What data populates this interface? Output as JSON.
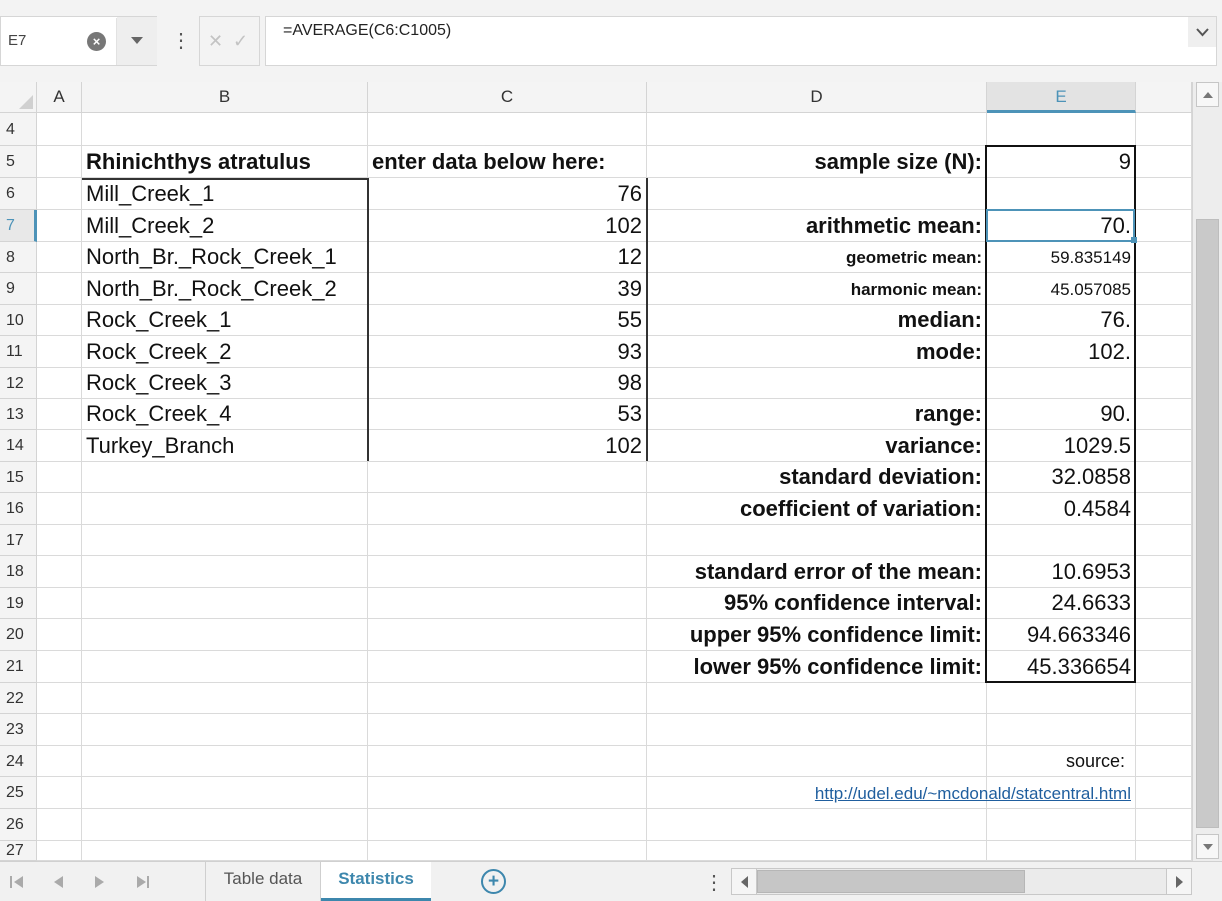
{
  "formula_bar": {
    "name_box": "E7",
    "clear_icon": "clear-circle-icon",
    "dropdown_icon": "chevron-down-icon",
    "cancel_glyph": "✕",
    "confirm_glyph": "✓",
    "formula": "=AVERAGE(C6:C1005)"
  },
  "columns": [
    "A",
    "B",
    "C",
    "D",
    "E"
  ],
  "selected_column": "E",
  "rows": [
    "4",
    "5",
    "6",
    "7",
    "8",
    "9",
    "10",
    "11",
    "12",
    "13",
    "14",
    "15",
    "16",
    "17",
    "18",
    "19",
    "20",
    "21",
    "22",
    "23",
    "24",
    "25",
    "26",
    "27"
  ],
  "selected_row": "7",
  "sheet": {
    "B5": "Rhinichthys atratulus",
    "C5": "enter data below here:",
    "sites": [
      {
        "name": "Mill_Creek_1",
        "value": "76"
      },
      {
        "name": "Mill_Creek_2",
        "value": "102"
      },
      {
        "name": "North_Br._Rock_Creek_1",
        "value": "12"
      },
      {
        "name": "North_Br._Rock_Creek_2",
        "value": "39"
      },
      {
        "name": "Rock_Creek_1",
        "value": "55"
      },
      {
        "name": "Rock_Creek_2",
        "value": "93"
      },
      {
        "name": "Rock_Creek_3",
        "value": "98"
      },
      {
        "name": "Rock_Creek_4",
        "value": "53"
      },
      {
        "name": "Turkey_Branch",
        "value": "102"
      }
    ],
    "stats": {
      "sample_size_label": "sample size (N):",
      "sample_size": "9",
      "arith_mean_label": "arithmetic mean:",
      "arith_mean": "70.",
      "geo_mean_label": "geometric mean:",
      "geo_mean": "59.835149",
      "harm_mean_label": "harmonic mean:",
      "harm_mean": "45.057085",
      "median_label": "median:",
      "median": "76.",
      "mode_label": "mode:",
      "mode": "102.",
      "range_label": "range:",
      "range": "90.",
      "variance_label": "variance:",
      "variance": "1029.5",
      "sd_label": "standard deviation:",
      "sd": "32.0858",
      "cv_label": "coefficient of variation:",
      "cv": "0.4584",
      "sem_label": "standard error of the mean:",
      "sem": "10.6953",
      "ci_label": "95% confidence interval:",
      "ci": "24.6633",
      "upper_label": "upper 95% confidence limit:",
      "upper": "94.663346",
      "lower_label": "lower 95% confidence limit:",
      "lower": "45.336654"
    },
    "source_label": "source:",
    "source_url": "http://udel.edu/~mcdonald/statcentral.html"
  },
  "tabs": [
    {
      "label": "Table data",
      "active": false
    },
    {
      "label": "Statistics",
      "active": true
    }
  ],
  "add_sheet_glyph": "+",
  "more_glyph": "⋮",
  "colors": {
    "accent": "#4d93b8",
    "link": "#1f5e9e"
  }
}
